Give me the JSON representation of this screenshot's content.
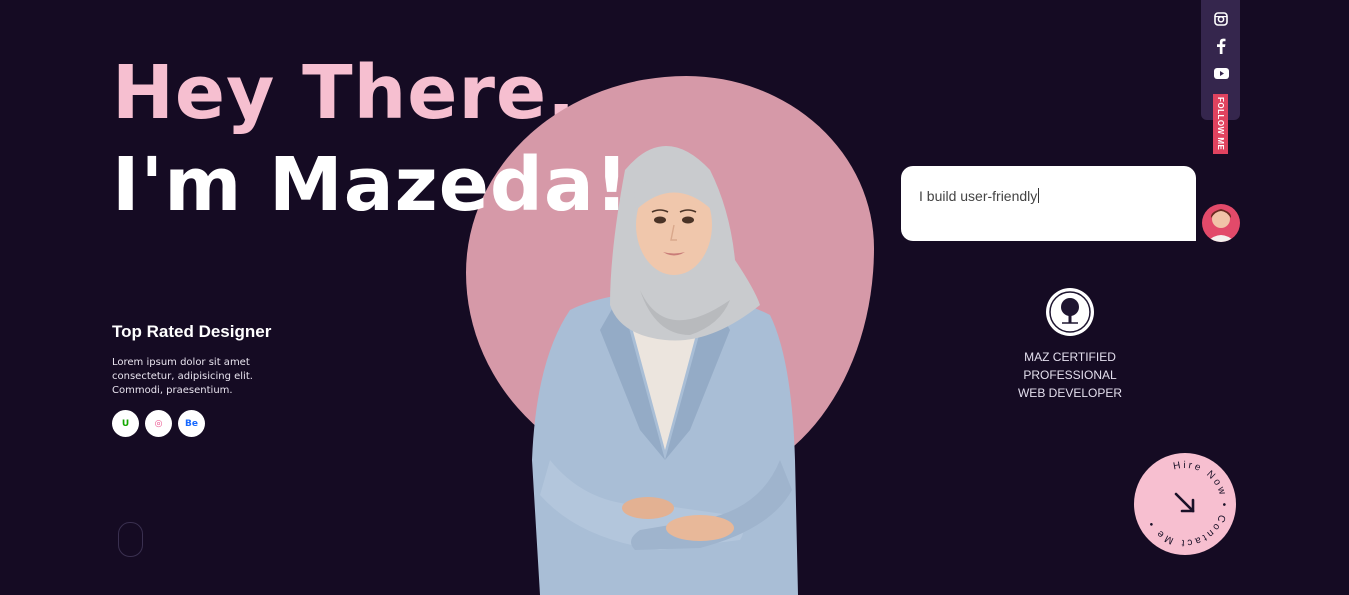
{
  "hero": {
    "line1": "Hey There,",
    "line2": "I'm Mazeda!"
  },
  "info": {
    "title": "Top Rated Designer",
    "description": "Lorem ipsum dolor sit amet consectetur, adipisicing elit. Commodi, praesentium.",
    "socials": [
      {
        "name": "upwork",
        "glyph": "U"
      },
      {
        "name": "dribbble",
        "glyph": "◎"
      },
      {
        "name": "behance",
        "glyph": "Be"
      }
    ]
  },
  "chat": {
    "text": "I build user-friendly"
  },
  "certification": {
    "lines": [
      "MAZ CERTIFIED",
      "PROFESSIONAL",
      "WEB DEVELOPER"
    ]
  },
  "social_bar": {
    "icons": [
      "instagram-icon",
      "facebook-icon",
      "youtube-icon"
    ],
    "follow_label": "FOLLOW ME"
  },
  "hire_badge": {
    "text": "Hire Now • Contact Me •"
  },
  "colors": {
    "background": "#150b23",
    "accent_pink": "#f6bfd0",
    "blob": "#d699a8",
    "follow_red": "#e0435f"
  }
}
